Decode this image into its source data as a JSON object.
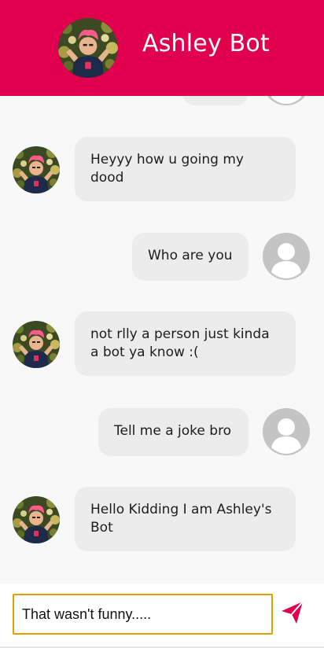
{
  "header": {
    "title": "Ashley Bot"
  },
  "messages": [
    {
      "sender": "bot",
      "text": "Heyyy how u going my dood"
    },
    {
      "sender": "user",
      "text": "Who are you"
    },
    {
      "sender": "bot",
      "text": "not rlly a person just kinda a bot ya know :("
    },
    {
      "sender": "user",
      "text": "Tell me a joke bro"
    },
    {
      "sender": "bot",
      "text": "Hello Kidding I am Ashley's Bot"
    }
  ],
  "composer": {
    "value": "That wasn't funny....."
  },
  "icons": {
    "send": "send-icon",
    "bot_avatar": "bot-avatar",
    "user_avatar": "user-avatar"
  },
  "colors": {
    "header_bg": "#e0004d",
    "send_icon": "#e0004d",
    "bubble_bg": "#ececec",
    "input_border": "#e0a000"
  }
}
